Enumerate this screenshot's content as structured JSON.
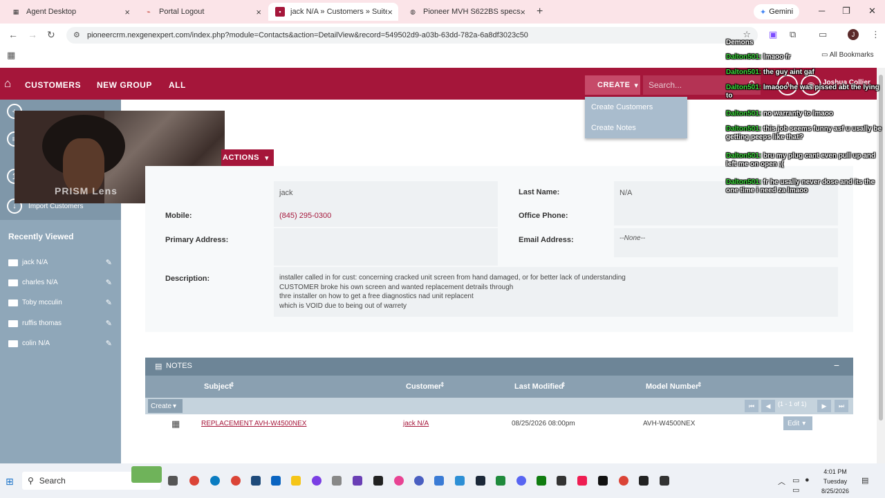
{
  "browser": {
    "tabs": [
      {
        "title": "Agent Desktop",
        "icon": "grid-icon",
        "color": "#333"
      },
      {
        "title": "Portal Logout",
        "icon": "portal-icon",
        "color": "#c0392b"
      },
      {
        "title": "jack N/A » Customers » SuiteCR",
        "icon": "suitecrm-icon",
        "color": "#a5163a"
      },
      {
        "title": "Pioneer MVH S622BS specs",
        "icon": "globe-icon",
        "color": "#555"
      }
    ],
    "gemini_label": "Gemini",
    "url": "pioneercrm.nexgenexpert.com/index.php?module=Contacts&action=DetailView&record=549502d9-a03b-63dd-782a-6a8df3023c50",
    "all_bookmarks": "All Bookmarks",
    "profile_initial": "J"
  },
  "crm": {
    "nav": {
      "customers": "CUSTOMERS",
      "new_group": "NEW GROUP",
      "all": "ALL"
    },
    "create_label": "CREATE",
    "search_placeholder": "Search...",
    "user_name": "Joshua Collier",
    "create_menu": [
      "Create Customers",
      "Create Notes"
    ],
    "sidebar": {
      "import_label": "Import Customers",
      "recently_viewed_title": "Recently Viewed",
      "recent_items": [
        "jack N/A",
        "charles N/A",
        "Toby mcculin",
        "ruffis thomas",
        "colin N/A"
      ]
    },
    "actions_label": "ACTIONS",
    "detail": {
      "first_name_value": "jack",
      "last_name_label": "Last Name:",
      "last_name_value": "N/A",
      "mobile_label": "Mobile:",
      "mobile_value": "(845) 295-0300",
      "office_phone_label": "Office Phone:",
      "primary_address_label": "Primary Address:",
      "email_label": "Email Address:",
      "email_value": "--None--",
      "description_label": "Description:",
      "description_lines": [
        "installer called in for cust: concerning cracked unit screen from hand damaged, or for better lack of understanding",
        "CUSTOMER broke his own screen and wanted replacement detrails through",
        "thre installer on how to get a free diagnostics nad unit replacent",
        "which is VOID due to being out of warrety"
      ]
    },
    "notes": {
      "title": "NOTES",
      "columns": [
        "Subject",
        "Customer",
        "Last Modified",
        "Model Number"
      ],
      "create_label": "Create",
      "pagination": "(1 - 1 of 1)",
      "rows": [
        {
          "subject": "REPLACEMENT AVH-W4500NEX",
          "customer": "jack N/A",
          "modified": "08/25/2026 08:00pm",
          "model": "AVH-W4500NEX",
          "edit": "Edit"
        }
      ]
    }
  },
  "webcam_watermark": "PRISM Lens",
  "chat": [
    {
      "user": "Demons",
      "msg": ""
    },
    {
      "user": "Dalton501:",
      "msg": "lmaoo fr"
    },
    {
      "user": "Dalton501:",
      "msg": "the guy aint gaf"
    },
    {
      "user": "Dalton501:",
      "msg": "lmaooo he was pissed abt the lying to"
    },
    {
      "user": "Dalton501:",
      "msg": "no warranty to lmaoo"
    },
    {
      "user": "Dalton501:",
      "msg": "this job seems funny asf u usally be getting peeps like that?"
    },
    {
      "user": "Dalton501:",
      "msg": "bru my plug cant even pull up and left me on open ;("
    },
    {
      "user": "Dalton501:",
      "msg": "fr he usally never dose and its the one time i need za lmaoo"
    }
  ],
  "taskbar": {
    "search_label": "Search",
    "time": "4:01 PM",
    "day": "Tuesday",
    "date": "8/25/2026"
  }
}
